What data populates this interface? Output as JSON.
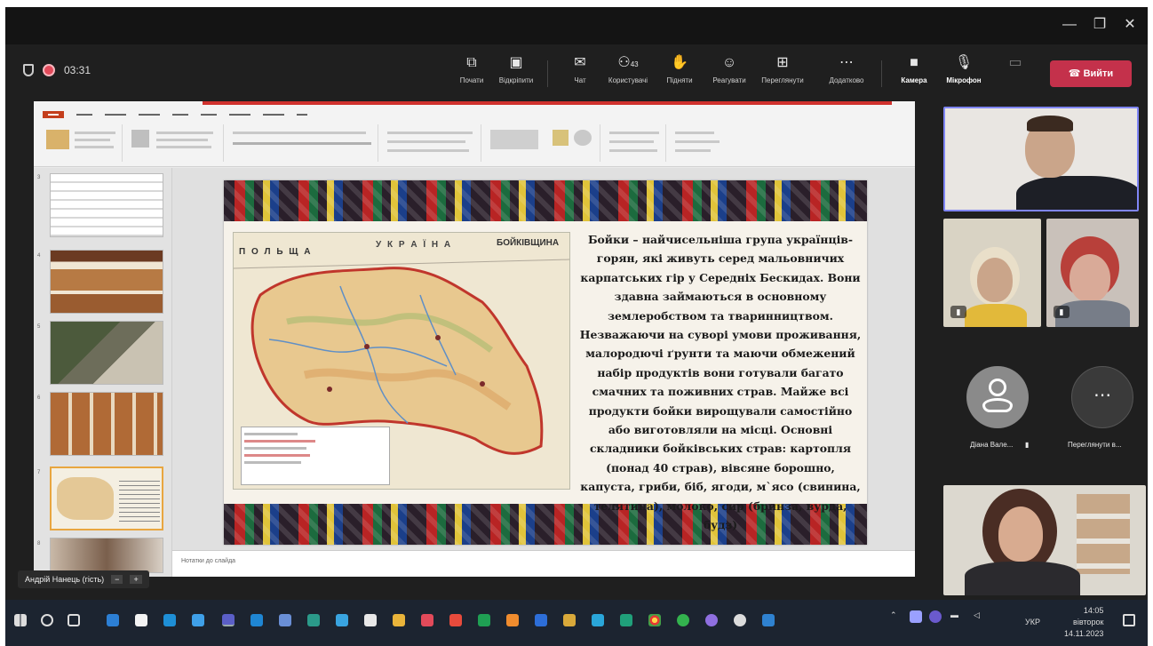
{
  "window": {
    "controls": [
      "—",
      "❐",
      "✕"
    ]
  },
  "meeting": {
    "timer": "03:31",
    "toolbar": [
      {
        "id": "share",
        "label": "Почати",
        "icon": "share-screen-icon",
        "glyph": "⧉"
      },
      {
        "id": "detach",
        "label": "Відкріпити",
        "icon": "window-icon",
        "glyph": "▣"
      },
      {
        "id": "chat",
        "label": "Чат",
        "icon": "chat-icon",
        "glyph": "✉"
      },
      {
        "id": "people",
        "label": "Користувачі",
        "icon": "people-icon",
        "glyph": "⚇",
        "count": "43"
      },
      {
        "id": "raise",
        "label": "Підняти",
        "icon": "raise-hand-icon",
        "glyph": "✋"
      },
      {
        "id": "react",
        "label": "Реагувати",
        "icon": "emoji-icon",
        "glyph": "☺"
      },
      {
        "id": "rooms",
        "label": "Переглянути",
        "icon": "rooms-icon",
        "glyph": "⊞"
      },
      {
        "id": "more",
        "label": "Додатково",
        "icon": "more-icon",
        "glyph": "⋯"
      },
      {
        "id": "camera",
        "label": "Камера",
        "icon": "camera-icon",
        "glyph": "■"
      },
      {
        "id": "mic",
        "label": "Мікрофон",
        "icon": "mic-off-icon",
        "glyph": "🎙"
      },
      {
        "id": "sharebtn",
        "label": "",
        "icon": "share-tray-icon",
        "glyph": "▭"
      }
    ],
    "leave_label": "Вийти",
    "leave_color": "#c4314b"
  },
  "slide": {
    "map": {
      "label_poland": "П О Л Ь Щ А",
      "label_ukraine": "У К Р А Ї Н А",
      "label_region": "БОЙКІВЩИНА"
    },
    "text": "Бойки – найчисельніша група українців-горян, які живуть серед мальовничих карпатських гір у Середніх Бескидах. Вони здавна займаються в основному землеробством та тваринництвом. Незважаючи на суворі умови проживання, малородючі ґрунти та маючи обмежений набір продуктів вони готували багато смачних та поживних страв. Майже всі продукти бойки вирощували самостійно або виготовляли на місці. Основні складники бойківських страв: картопля (понад 40 страв), вівсяне борошно, капуста, гриби, біб, ягоди, м`ясо (свинина, телятина), молоко, сир (бринза, вурда, будз)"
  },
  "powerpoint": {
    "notes_placeholder": "Нотатки до слайда"
  },
  "participants": {
    "avatar_name": "Дiана Вале...",
    "overflow_name": "Переглянути в..."
  },
  "sharer": {
    "name": "Андрій Нанець (гість)"
  },
  "taskbar": {
    "lang": "УКР",
    "time": "14:05",
    "day": "вівторок",
    "date": "14.11.2023"
  }
}
